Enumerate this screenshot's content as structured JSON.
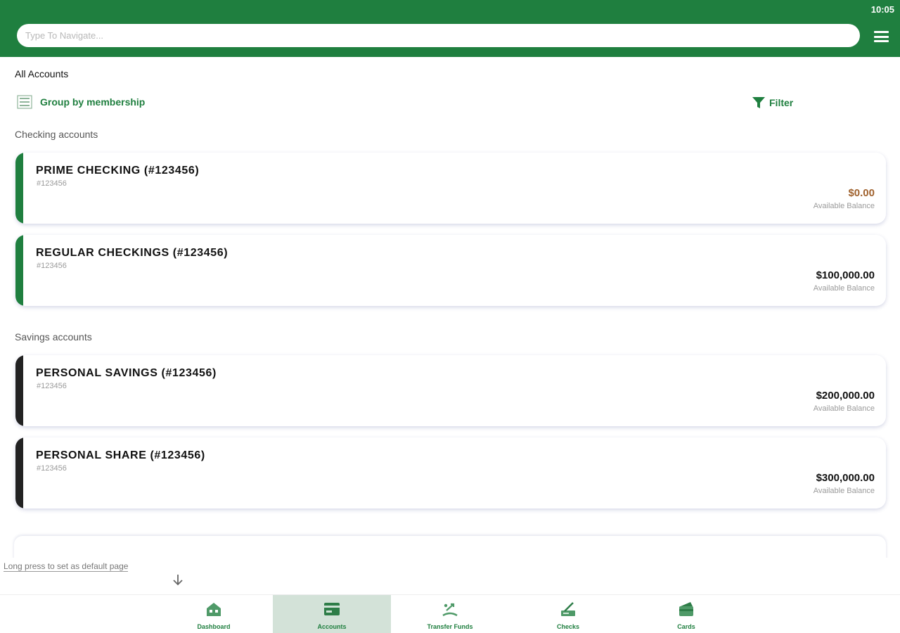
{
  "status_bar": {
    "time": "10:05"
  },
  "header": {
    "search_placeholder": "Type To Navigate..."
  },
  "page": {
    "title": "All Accounts"
  },
  "toolbar": {
    "group_label": "Group by membership",
    "filter_label": "Filter"
  },
  "sections": [
    {
      "title": "Checking accounts",
      "accounts": [
        {
          "name": "PRIME CHECKING (#123456)",
          "number": "#123456",
          "balance": "$0.00",
          "balance_label": "Available Balance",
          "balance_color": "#a0622e",
          "stripe_color": "#1f7f3f"
        },
        {
          "name": "REGULAR CHECKINGS (#123456)",
          "number": "#123456",
          "balance": "$100,000.00",
          "balance_label": "Available Balance",
          "balance_color": "#111111",
          "stripe_color": "#1f7f3f"
        }
      ]
    },
    {
      "title": "Savings accounts",
      "accounts": [
        {
          "name": "PERSONAL SAVINGS (#123456)",
          "number": "#123456",
          "balance": "$200,000.00",
          "balance_label": "Available Balance",
          "balance_color": "#111111",
          "stripe_color": "#222222"
        },
        {
          "name": "PERSONAL SHARE (#123456)",
          "number": "#123456",
          "balance": "$300,000.00",
          "balance_label": "Available Balance",
          "balance_color": "#111111",
          "stripe_color": "#222222"
        }
      ]
    }
  ],
  "default_page_hint": "Long press to set as default page",
  "bottom_nav": [
    {
      "label": "Dashboard",
      "icon": "dashboard-icon",
      "active": false
    },
    {
      "label": "Accounts",
      "icon": "accounts-icon",
      "active": true
    },
    {
      "label": "Transfer Funds",
      "icon": "transfer-funds-icon",
      "active": false
    },
    {
      "label": "Checks",
      "icon": "checks-icon",
      "active": false
    },
    {
      "label": "Cards",
      "icon": "cards-icon",
      "active": false
    }
  ],
  "colors": {
    "primary": "#1f7f3f",
    "active_nav_bg": "#d3e2d8"
  }
}
